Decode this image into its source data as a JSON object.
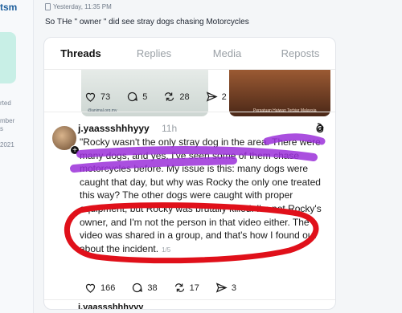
{
  "sidebar": {
    "username_fragment": "tsm",
    "meta_lines": [
      "rted",
      "mber",
      "s",
      "2021"
    ]
  },
  "post": {
    "date": "Yesterday, 11:35 PM",
    "text": "So THe \" owner \" did see stray dogs chasing Motorcycles"
  },
  "threads": {
    "tabs": [
      {
        "label": "Threads",
        "active": true
      },
      {
        "label": "Replies",
        "active": false
      },
      {
        "label": "Media",
        "active": false
      },
      {
        "label": "Reposts",
        "active": false
      }
    ],
    "previous_post": {
      "image_captions": [
        "@animal.org.my",
        "Persatuan Haiwan Terbiar Malaysia"
      ],
      "likes": "73",
      "comments": "5",
      "reposts": "28",
      "shares": "2"
    },
    "reply": {
      "username": "j.yaassshhhyyy",
      "time": "11h",
      "text": "\"Rocky wasn't the only stray dog in the area. There were many dogs, and yes, I've seen some of them chase motorcycles before. My issue is this: many dogs were caught that day, but why was Rocky the only one treated this way? The other dogs were caught with proper equipment, but Rocky was brutally killed. I'm not Rocky's owner, and I'm not the person in that video either. The video was shared in a group, and that's how I found out about the incident.",
      "counter": "1/5",
      "likes": "166",
      "comments": "38",
      "reposts": "17",
      "shares": "3"
    },
    "next_username": "j.yaassshhhyyy"
  },
  "annotations": {
    "highlight_color": "#9b30d9",
    "circle_color": "#e0101a"
  }
}
